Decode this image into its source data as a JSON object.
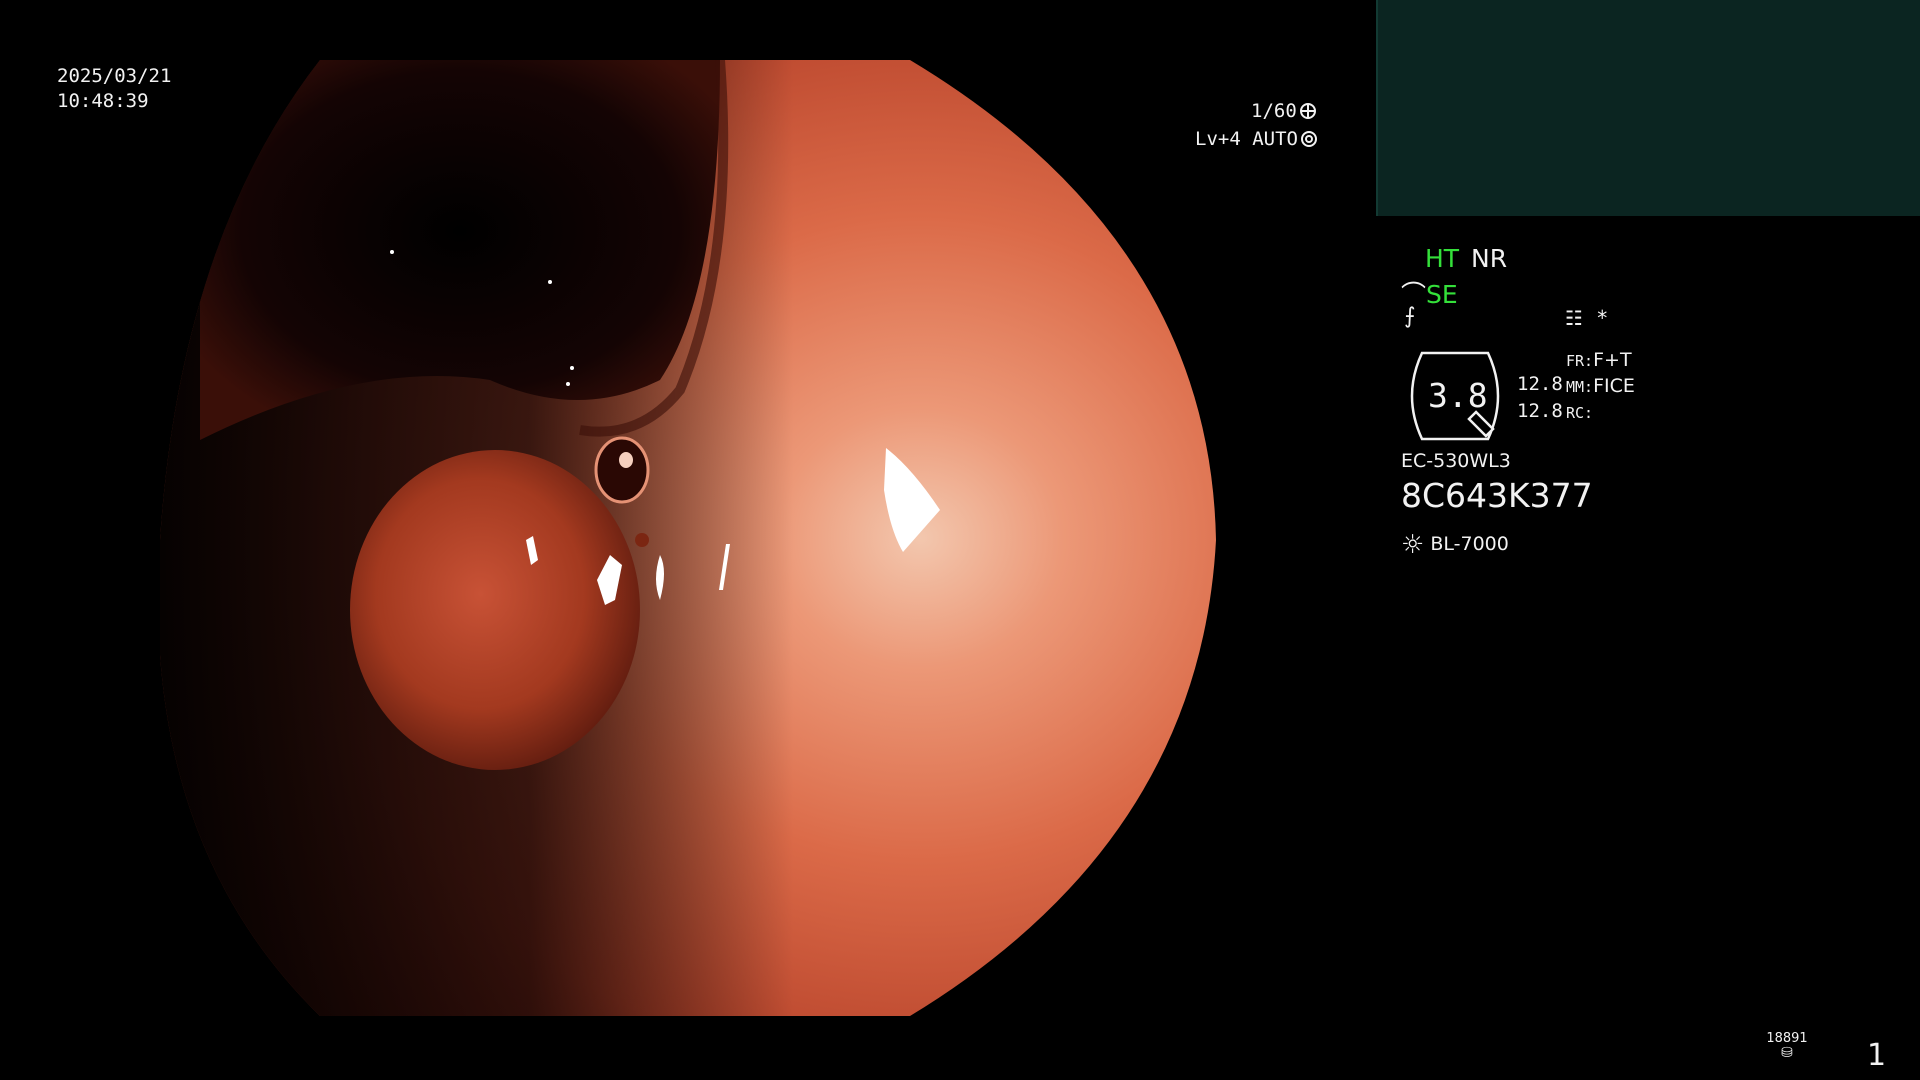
{
  "datetime": {
    "date": "2025/03/21",
    "time": "10:48:39"
  },
  "exposure": {
    "shutter": "1/60",
    "shutter_icon": "shutter-wheel-icon",
    "level": "Lv+4",
    "mode": "AUTO",
    "mode_icon": "iris-icon"
  },
  "panel": {
    "ht": "HT",
    "nr": "NR",
    "se": "SE",
    "se_icon": "enhance-curve-icon",
    "fn_icon": "gamma-slash-icon",
    "menu_icon": "list-icon",
    "star": "*",
    "zoom_value": "3.8",
    "zoom_icon": "zoom-lens-icon",
    "values": [
      "12.8",
      "12.8"
    ],
    "fr_label": "FR:",
    "fr_value": "F+T",
    "mm_label": "MM:",
    "mm_value": "FICE",
    "rc_label": "RC:",
    "scope_model": "EC-530WL3",
    "scope_serial": "8C643K377",
    "light_icon": "light-source-icon",
    "light_model": "BL-7000"
  },
  "footer": {
    "counter": "18891",
    "counter_icon": "storage-disk-icon",
    "page": "1"
  },
  "colors": {
    "accent_green": "#34e03a",
    "text": "#f2f2f2",
    "panel": "#0b2521"
  }
}
